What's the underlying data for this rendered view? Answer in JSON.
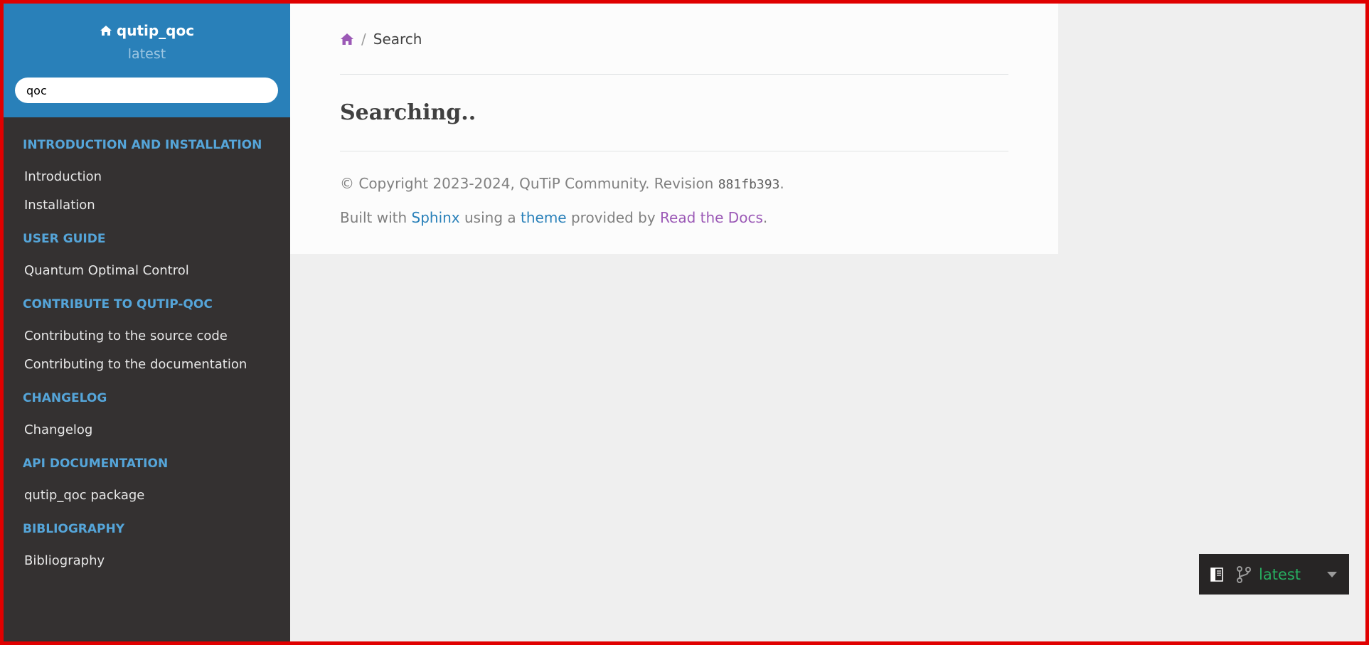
{
  "sidebar": {
    "project_name": "qutip_qoc",
    "version": "latest",
    "search_value": "qoc",
    "sections": [
      {
        "caption": "INTRODUCTION AND INSTALLATION",
        "items": [
          "Introduction",
          "Installation"
        ]
      },
      {
        "caption": "USER GUIDE",
        "items": [
          "Quantum Optimal Control"
        ]
      },
      {
        "caption": "CONTRIBUTE TO QUTIP-QOC",
        "items": [
          "Contributing to the source code",
          "Contributing to the documentation"
        ]
      },
      {
        "caption": "CHANGELOG",
        "items": [
          "Changelog"
        ]
      },
      {
        "caption": "API DOCUMENTATION",
        "items": [
          "qutip_qoc package"
        ]
      },
      {
        "caption": "BIBLIOGRAPHY",
        "items": [
          "Bibliography"
        ]
      }
    ]
  },
  "breadcrumb": {
    "separator": "/",
    "current": "Search"
  },
  "main": {
    "heading": "Searching.."
  },
  "footer": {
    "copyright_prefix": "© Copyright 2023-2024, QuTiP Community. Revision ",
    "revision": "881fb393",
    "period": ".",
    "built_with": "Built with ",
    "sphinx": "Sphinx",
    "using_a": " using a ",
    "theme": "theme",
    "provided_by": " provided by ",
    "rtd": "Read the Docs",
    "end": "."
  },
  "flyout": {
    "version": "latest"
  },
  "icons": {
    "home": "home-icon",
    "book": "book-icon",
    "branch": "git-branch-icon",
    "caret": "caret-down-icon"
  },
  "colors": {
    "sidebar_top": "#2980b9",
    "sidebar_bg": "#343131",
    "caption": "#55a5d9",
    "link": "#2980b9",
    "visited": "#9b59b6",
    "version_green": "#27ae60",
    "frame_border": "#e00000"
  }
}
